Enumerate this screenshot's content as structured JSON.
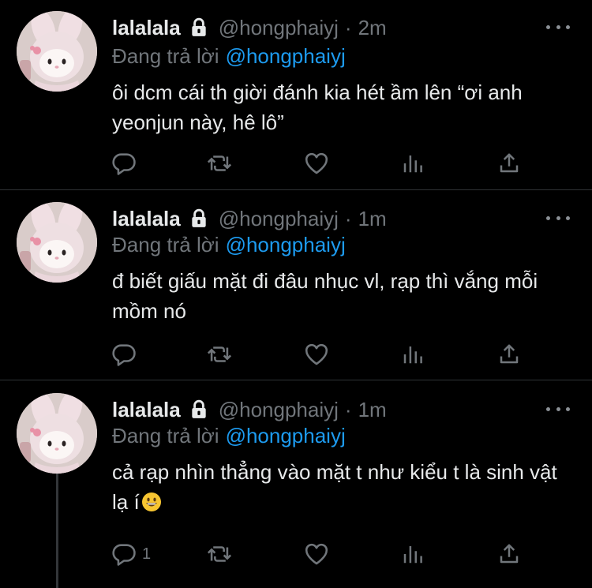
{
  "colors": {
    "background": "#000000",
    "text": "#e7e9ea",
    "secondary": "#71767b",
    "mention": "#1d9bf0",
    "divider": "#2f3336"
  },
  "tweets": [
    {
      "name": "lalalala",
      "handle": "@hongphaiyj",
      "separator": "·",
      "time": "2m",
      "replying_label": "Đang trả lời",
      "replying_to": "@hongphaiyj",
      "text": "ôi dcm cái th giời đánh kia hét ầm lên “ơi anh yeonjun này, hê lô”",
      "reply_count": ""
    },
    {
      "name": "lalalala",
      "handle": "@hongphaiyj",
      "separator": "·",
      "time": "1m",
      "replying_label": "Đang trả lời",
      "replying_to": "@hongphaiyj",
      "text": "đ biết giấu mặt đi đâu nhục vl, rạp thì vắng mỗi mồm nó",
      "reply_count": ""
    },
    {
      "name": "lalalala",
      "handle": "@hongphaiyj",
      "separator": "·",
      "time": "1m",
      "replying_label": "Đang trả lời",
      "replying_to": "@hongphaiyj",
      "text": "cả rạp nhìn thẳng vào mặt t như kiểu t là sinh vật lạ í",
      "emoji": "grinning-face",
      "reply_count": "1"
    }
  ],
  "icons": [
    "lock-icon",
    "more-icon",
    "reply-icon",
    "retweet-icon",
    "like-icon",
    "views-icon",
    "share-icon"
  ]
}
